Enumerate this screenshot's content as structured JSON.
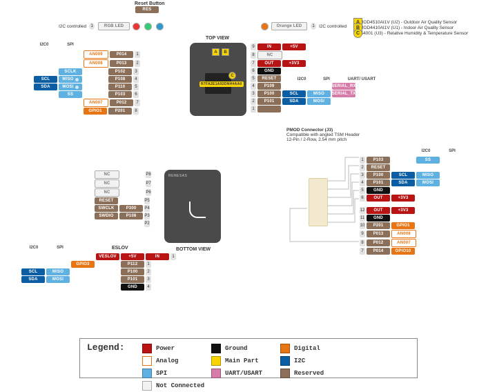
{
  "header": {
    "reset": "Reset Button",
    "resLbl": "RES",
    "rgb": {
      "label": "RGB LED",
      "note": "I2C controlled",
      "bullet": "1"
    },
    "orange": {
      "label": "Orange LED",
      "note": "I2C controlled",
      "bullet": "1"
    },
    "topview": "TOP VIEW",
    "bottomview": "BOTTOM VIEW"
  },
  "sensors": {
    "A": {
      "k": "A",
      "t": "ZMOD4510AI1V (U2) - Outdoor Air Quality Sensor"
    },
    "B": {
      "k": "B",
      "t": "ZMOD4410AI1V (U1) - Indoor Air Quality Sensor"
    },
    "C": {
      "k": "C",
      "t": "HS4001 (U3) - Relative Humidity & Temperature Sensor"
    }
  },
  "chipId": "R7FA2E1A92DNH#AA0",
  "top": {
    "leftHdr": {
      "i2c": "I2C0",
      "spi": "SPI"
    },
    "rightHdr": {
      "i2c": "I2C0",
      "spi": "SPI",
      "uart": "UART/ USART"
    },
    "leftI2C": [
      "SCL",
      "SDA"
    ],
    "leftSPI": [
      "SCLK",
      "MISO",
      "MOSI",
      "SS"
    ],
    "leftSPIdots": [
      "D",
      "D"
    ],
    "leftAnalog": [
      "AN009",
      "AN008",
      "",
      "",
      "",
      "",
      "AN007",
      "GPIO1"
    ],
    "leftRes": [
      "P014",
      "P013",
      "P102",
      "P108",
      "P110",
      "P103",
      "P012",
      "P201"
    ],
    "leftNums": [
      "1",
      "2",
      "3",
      "4",
      "5",
      "6",
      "7",
      "8"
    ],
    "rightNums": [
      "9",
      "8",
      "7",
      "6",
      "5",
      "4",
      "3",
      "2",
      "1"
    ],
    "rightPills": [
      {
        "c": "power",
        "t": "IN"
      },
      {
        "c": "nc",
        "t": "NC"
      },
      {
        "c": "power",
        "t": "OUT"
      },
      {
        "c": "ground",
        "t": "GND"
      },
      {
        "c": "res",
        "t": "RESET"
      },
      {
        "c": "res",
        "t": "P109"
      },
      {
        "c": "res",
        "t": "P100"
      },
      {
        "c": "res",
        "t": "P101"
      },
      {
        "c": "res",
        "t": ""
      }
    ],
    "rightVolt": [
      "+5V",
      "",
      "+3V3",
      "",
      "",
      "",
      "",
      "",
      ""
    ],
    "rightI2C": [
      "SCL",
      "SDA"
    ],
    "rightI2Cd": [
      "D",
      "D"
    ],
    "rightSPI": [
      "MISO",
      "MOSI"
    ],
    "rightUART": [
      "SERIAL_RX",
      "SERIAL_TX"
    ]
  },
  "bot": {
    "leftHdr": {
      "i2c": "I2C0",
      "spi": "SPI"
    },
    "leftI2C": [
      "SCL",
      "SDA"
    ],
    "leftI2Cd": [
      "D",
      "D"
    ],
    "leftSPI": [
      "MISO",
      "MOSI"
    ],
    "res1": [
      "NC",
      "NC",
      "NC",
      "RESET",
      "SWCLK",
      "SWDIO",
      ""
    ],
    "res1b": [
      "",
      "",
      "",
      "",
      "P300",
      "P108",
      ""
    ],
    "res1n": [
      "P8",
      "P7",
      "P6",
      "P5",
      "P4",
      "P3",
      "P2"
    ],
    "eslov": "ESLOV",
    "eslovRow": [
      "VESLOV",
      "+5V",
      "IN"
    ],
    "gpio": "GPIO3",
    "res2": [
      "P112",
      "P100",
      "P101",
      "GND"
    ],
    "res2n": [
      "1",
      "2",
      "3",
      "4"
    ]
  },
  "pmod": {
    "title": "PMOD Connector (J3)",
    "sub1": "Compatible with angled TSM Header",
    "sub2": "12-Pin / 2-Row, 2.54 mm pitch",
    "rightHdr": {
      "i2c": "I2C0",
      "spi": "SPI"
    },
    "leftNums": [
      "1",
      "2",
      "3",
      "4",
      "5",
      "6",
      "12",
      "11",
      "10",
      "9",
      "8",
      "7"
    ],
    "leftRes": [
      "P103",
      "RESET",
      "P100",
      "P101",
      "GND",
      "OUT",
      "OUT",
      "GND",
      "P201",
      "P013",
      "P012",
      "P014"
    ],
    "leftV": [
      "",
      "",
      "",
      "",
      "",
      "+3V3",
      "+3V3",
      "",
      "",
      "",
      "",
      ""
    ],
    "rightI2C": [
      "",
      "",
      "SCL",
      "SDA"
    ],
    "rightSPI": [
      "SS",
      "",
      "MISO",
      "MOSI"
    ],
    "rightDig": [
      "",
      "",
      "GPIO1",
      "AN008",
      "AN007",
      "GPIO10"
    ],
    "rightDigStart": 8
  },
  "legend": {
    "title": "Legend:",
    "items": [
      {
        "c": "--c-power",
        "t": "Power"
      },
      {
        "c": "--c-ground",
        "t": "Ground"
      },
      {
        "c": "--c-digital",
        "t": "Digital"
      },
      {
        "c": "--c-analog",
        "t": "Analog",
        "b": "--c-analog-b"
      },
      {
        "c": "--c-main",
        "t": "Main Part"
      },
      {
        "c": "--c-i2c",
        "t": "I2C"
      },
      {
        "c": "--c-spi",
        "t": "SPI"
      },
      {
        "c": "--c-uart",
        "t": "UART/USART"
      },
      {
        "c": "--c-res",
        "t": "Reserved"
      },
      {
        "c": "--c-nc",
        "t": "Not Connected",
        "b": "#aaa"
      }
    ]
  }
}
